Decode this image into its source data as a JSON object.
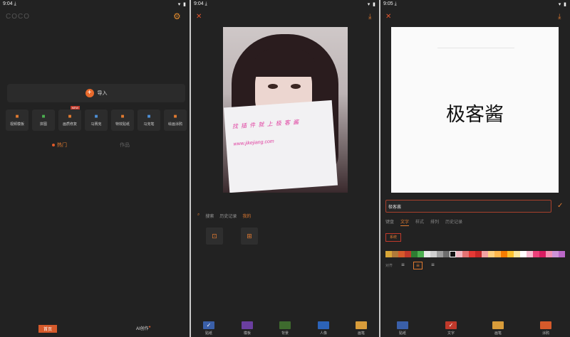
{
  "colors": {
    "accent": "#e07a30",
    "panel_bg": "#222222"
  },
  "panel1": {
    "status": {
      "time": "9:04",
      "download_icon": "download-arrow-icon",
      "sys_icons": "wifi-icon battery-icon"
    },
    "logo": "COCO",
    "settings_icon": "gear-icon",
    "import_label": "导入",
    "tools": [
      {
        "label": "视频模板",
        "icon": "video-template-icon",
        "color": "#e07a30"
      },
      {
        "label": "拼图",
        "icon": "collage-icon",
        "color": "#4caf50"
      },
      {
        "label": "画质修复",
        "icon": "quality-repair-icon",
        "color": "#e07a30",
        "badge": "NEW"
      },
      {
        "label": "马赛克",
        "icon": "mosaic-icon",
        "color": "#4d8fd6"
      },
      {
        "label": "特效贴纸",
        "icon": "effect-sticker-icon",
        "color": "#e07a30"
      },
      {
        "label": "马克笔",
        "icon": "marker-pen-icon",
        "color": "#4d8fd6"
      },
      {
        "label": "绘画涂鸦",
        "icon": "paint-graffiti-icon",
        "color": "#e07a30"
      }
    ],
    "tabs": {
      "hot": "热门",
      "works": "作品"
    },
    "bottom_nav": {
      "home": "首页",
      "ai": "AI创作"
    }
  },
  "panel2": {
    "status": {
      "time": "9:04",
      "download_icon": "download-arrow-icon",
      "sys_icons": "wifi-icon battery-icon"
    },
    "photo_sign": {
      "line1": "找 插 件 就 上 极 客 酱",
      "line2": "www.jikejiang.com"
    },
    "content_tabs": [
      "搜索",
      "历史记录",
      "我的"
    ],
    "option_icons": [
      "add-image-icon",
      "add-sticker-icon"
    ],
    "bottom_tabs": [
      {
        "label": "贴纸",
        "color": "#3a5fa8",
        "active": true
      },
      {
        "label": "模板",
        "color": "#6b3fa0",
        "active": false
      },
      {
        "label": "背景",
        "color": "#3e6b2e",
        "active": false
      },
      {
        "label": "人像",
        "color": "#2c63b8",
        "active": false
      },
      {
        "label": "画笔",
        "color": "#d89c3a",
        "active": false
      }
    ]
  },
  "panel3": {
    "status": {
      "time": "9:05",
      "download_icon": "download-arrow-icon",
      "sys_icons": "wifi-icon battery-icon"
    },
    "canvas_text": "极客酱",
    "text_input_value": "极客酱",
    "edit_tabs": [
      "键盘",
      "文字",
      "样式",
      "排列",
      "历史记录"
    ],
    "system_label": "系统",
    "palette": [
      "#d8a637",
      "#b07a3a",
      "#d65a2b",
      "#c0392b",
      "#2e7d32",
      "#4caf50",
      "#e8e8e8",
      "#cfcfcf",
      "#9e9e9e",
      "#6e6e6e",
      "#111111",
      "#f2b8c2",
      "#e57373",
      "#e53935",
      "#c62828",
      "#f4a3a3",
      "#ffd180",
      "#ffb74d",
      "#f57c00",
      "#fbc02d",
      "#f9e79f",
      "#ffffff",
      "#f8bbd0",
      "#ec407a",
      "#d81b60",
      "#f48fb1",
      "#ce93d8",
      "#ba68c8"
    ],
    "palette_selected": 10,
    "align_label": "对齐",
    "align_icons": [
      "align-left-icon",
      "align-center-icon",
      "align-right-icon"
    ],
    "bottom_tabs": [
      {
        "label": "贴纸",
        "color": "#3a5fa8",
        "active": false
      },
      {
        "label": "文字",
        "color": "#c0392b",
        "active": true
      },
      {
        "label": "画笔",
        "color": "#d89c3a",
        "active": false
      },
      {
        "label": "涂鸦",
        "color": "#d65a2b",
        "active": false
      }
    ]
  }
}
